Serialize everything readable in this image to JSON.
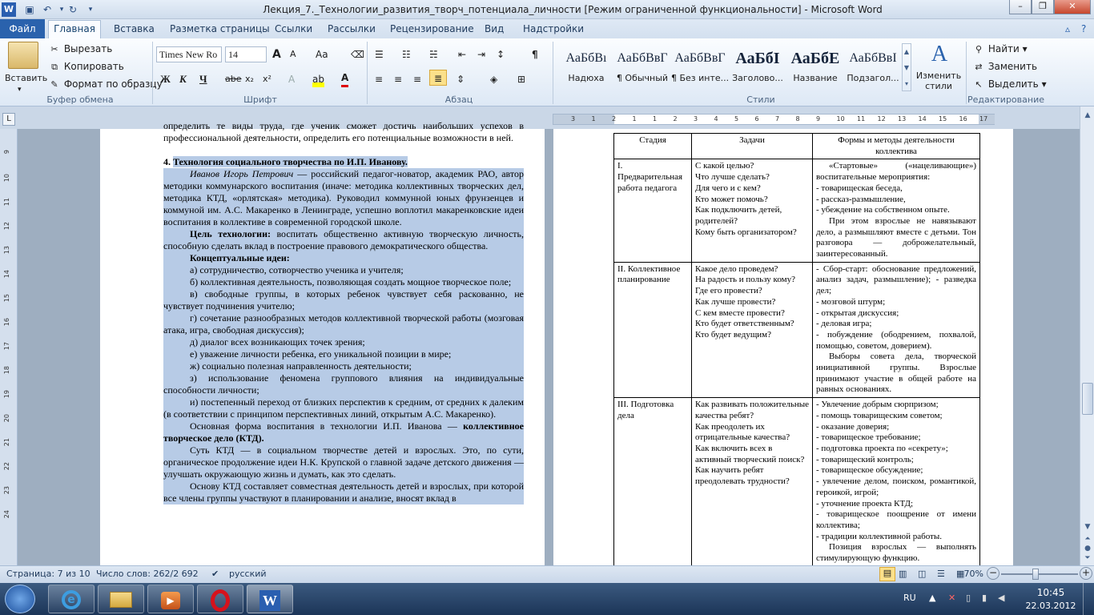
{
  "window": {
    "title": "Лекция_7._Технологии_развития_творч_потенциала_личности [Режим ограниченной функциональности]  -  Microsoft Word",
    "app_icon": "W"
  },
  "tabs": {
    "file": "Файл",
    "items": [
      "Главная",
      "Вставка",
      "Разметка страницы",
      "Ссылки",
      "Рассылки",
      "Рецензирование",
      "Вид",
      "Надстройки"
    ]
  },
  "clipboard": {
    "paste": "Вставить",
    "cut": "Вырезать",
    "copy": "Копировать",
    "format_painter": "Формат по образцу",
    "group_label": "Буфер обмена"
  },
  "font": {
    "family": "Times New Ro",
    "size": "14",
    "group_label": "Шрифт",
    "bold": "Ж",
    "italic": "К",
    "underline": "Ч",
    "strike": "abe",
    "sub": "x₂",
    "sup": "x²",
    "grow": "A",
    "shrink": "A",
    "case": "Aa"
  },
  "paragraph": {
    "group_label": "Абзац"
  },
  "styles": {
    "group_label": "Стили",
    "items": [
      {
        "sample": "АаБбВı",
        "name": "Надюха"
      },
      {
        "sample": "АаБбВвГ",
        "name": "¶ Обычный"
      },
      {
        "sample": "АаБбВвГ",
        "name": "¶ Без инте..."
      },
      {
        "sample": "АаБбI",
        "name": "Заголово..."
      },
      {
        "sample": "АаБбЕ",
        "name": "Название"
      },
      {
        "sample": "АаБбВвІ",
        "name": "Подзагол..."
      }
    ],
    "change_styles": "Изменить стили"
  },
  "editing": {
    "group_label": "Редактирование",
    "find": "Найти",
    "replace": "Заменить",
    "select": "Выделить"
  },
  "ruler": {
    "horizontal": [
      "3",
      "1",
      "2",
      "1",
      "1",
      "2",
      "3",
      "4",
      "5",
      "6",
      "7",
      "8",
      "9",
      "10",
      "11",
      "12",
      "13",
      "14",
      "15",
      "16",
      "17"
    ],
    "vertical": [
      "9",
      "10",
      "11",
      "12",
      "13",
      "14",
      "15",
      "16",
      "17",
      "18",
      "19",
      "20",
      "21",
      "22",
      "23",
      "24"
    ]
  },
  "page1": {
    "top_text": "определить те виды труда, где ученик сможет достичь наибольших успехов в профессиональной деятельности, определить его потенциальные возможности в ней.",
    "heading_num": "4.",
    "heading": "Технология социального творчества по И.П. Иванову.",
    "intro_name": "Иванов Игорь Петрович",
    "intro": " — российский педагог-новатор, академик РАО, автор методики коммунарского воспитания (иначе: методика коллективных творческих дел, методика КТД, «орлятская» методика). Руководил коммунной юных фрунзенцев и коммуной им. А.С. Макаренко в Ленинграде, успешно воплотил макаренковские идеи воспитания в коллективе в современной городской школе.",
    "goal_label": "Цель технологии:",
    "goal": " воспитать общественно активную творческую личность, способную сделать вклад в построение правового демократического общества.",
    "ideas_label": "Концептуальные идеи:",
    "ideas": [
      "а) сотрудничество, сотворчество ученика и учителя;",
      "б) коллективная деятельность, позволяющая создать мощное творческое поле;",
      "в) свободные группы, в которых ребенок чувствует себя раскованно, не чувствует подчинения учителю;",
      "г) сочетание разнообразных методов коллективной творческой работы (мозговая атака, игра, свободная дискуссия);",
      "д) диалог всех возникающих точек зрения;",
      "е) уважение личности ребенка, его уникальной позиции в мире;",
      "ж) социально полезная направленность деятельности;",
      "з) использование феномена группового влияния на индивидуальные способности личности;",
      "и) постепенный переход от близких перспектив к средним, от средних к далеким (в соответствии с принципом перспективных линий, открытым А.С. Макаренко)."
    ],
    "form_text": "Основная форма воспитания в технологии И.П. Иванова — ",
    "form_bold": "коллективное творческое дело (КТД).",
    "essence": "Суть КТД — в социальном творчестве детей и взрослых. Это, по сути, органическое продолжение идеи Н.К. Крупской о главной задаче детского движения — улучшать окружающую жизнь и думать, как это сделать.",
    "basis": "Основу КТД составляет совместная деятельность детей и взрослых, при которой все члены группы участвуют в планировании и анализе, вносят вклад в"
  },
  "table": {
    "headers": [
      "Стадия",
      "Задачи",
      "Формы и методы деятельности коллектива"
    ],
    "rows": [
      {
        "stage": "I. Предварительная работа педагога",
        "tasks": [
          "С какой целью?",
          "Что лучше сделать?",
          "Для чего и с кем?",
          "Кто может помочь?",
          "Как подключить детей, родителей?",
          "Кому быть организатором?"
        ],
        "forms": [
          "«Стартовые» («нацеливающие») воспитательные мероприятия:",
          "- товарищеская беседа,",
          "- рассказ-размышление,",
          "- убеждение на собственном опыте.",
          "При этом взрослые не навязывают дело, а размышляют вместе с детьми. Тон разговора — доброжелательный, заинтересованный."
        ]
      },
      {
        "stage": "II. Коллективное планирование",
        "tasks": [
          "Какое дело проведем?",
          "На радость и пользу кому?",
          "Где его провести?",
          "Как лучше провести?",
          "С кем вместе провести?",
          "Кто будет ответственным?",
          "Кто будет ведущим?"
        ],
        "forms": [
          "- Сбор-старт: обоснование предложений, анализ задач, размышление); - разведка дел;",
          "- мозговой штурм;",
          "- открытая дискуссия;",
          "- деловая игра;",
          "- побуждение (ободрением, похвалой, помощью, советом, доверием).",
          "Выборы совета дела, творческой инициативной группы. Взрослые принимают участие в общей работе на равных основаниях."
        ]
      },
      {
        "stage": "III. Подготовка дела",
        "tasks": [
          "Как развивать положительные качества ребят?",
          "Как преодолеть их отрицательные качества?",
          "Как включить всех в активный творческий поиск?",
          "Как научить ребят преодолевать трудности?"
        ],
        "forms": [
          "- Увлечение добрым сюрпризом;",
          "- помощь товарищеским советом;",
          "- оказание доверия;",
          "- товарищеское требование;",
          "- подготовка проекта по «секрету»;",
          "- товарищеский контроль;",
          "- товарищеское обсуждение;",
          "- увлечение делом, поиском, романтикой, героикой, игрой;",
          "- уточнение проекта КТД;",
          "- товарищеское поощрение от имени коллектива;",
          "- традиции коллективной работы.",
          "Позиция взрослых — выполнять стимулирующую функцию."
        ]
      }
    ]
  },
  "status": {
    "page": "Страница: 7 из 10",
    "words": "Число слов: 262/2 692",
    "language": "русский",
    "zoom": "70%",
    "zoom_fraction": 0.43
  },
  "taskbar": {
    "lang": "RU",
    "time": "10:45",
    "date": "22.03.2012"
  }
}
